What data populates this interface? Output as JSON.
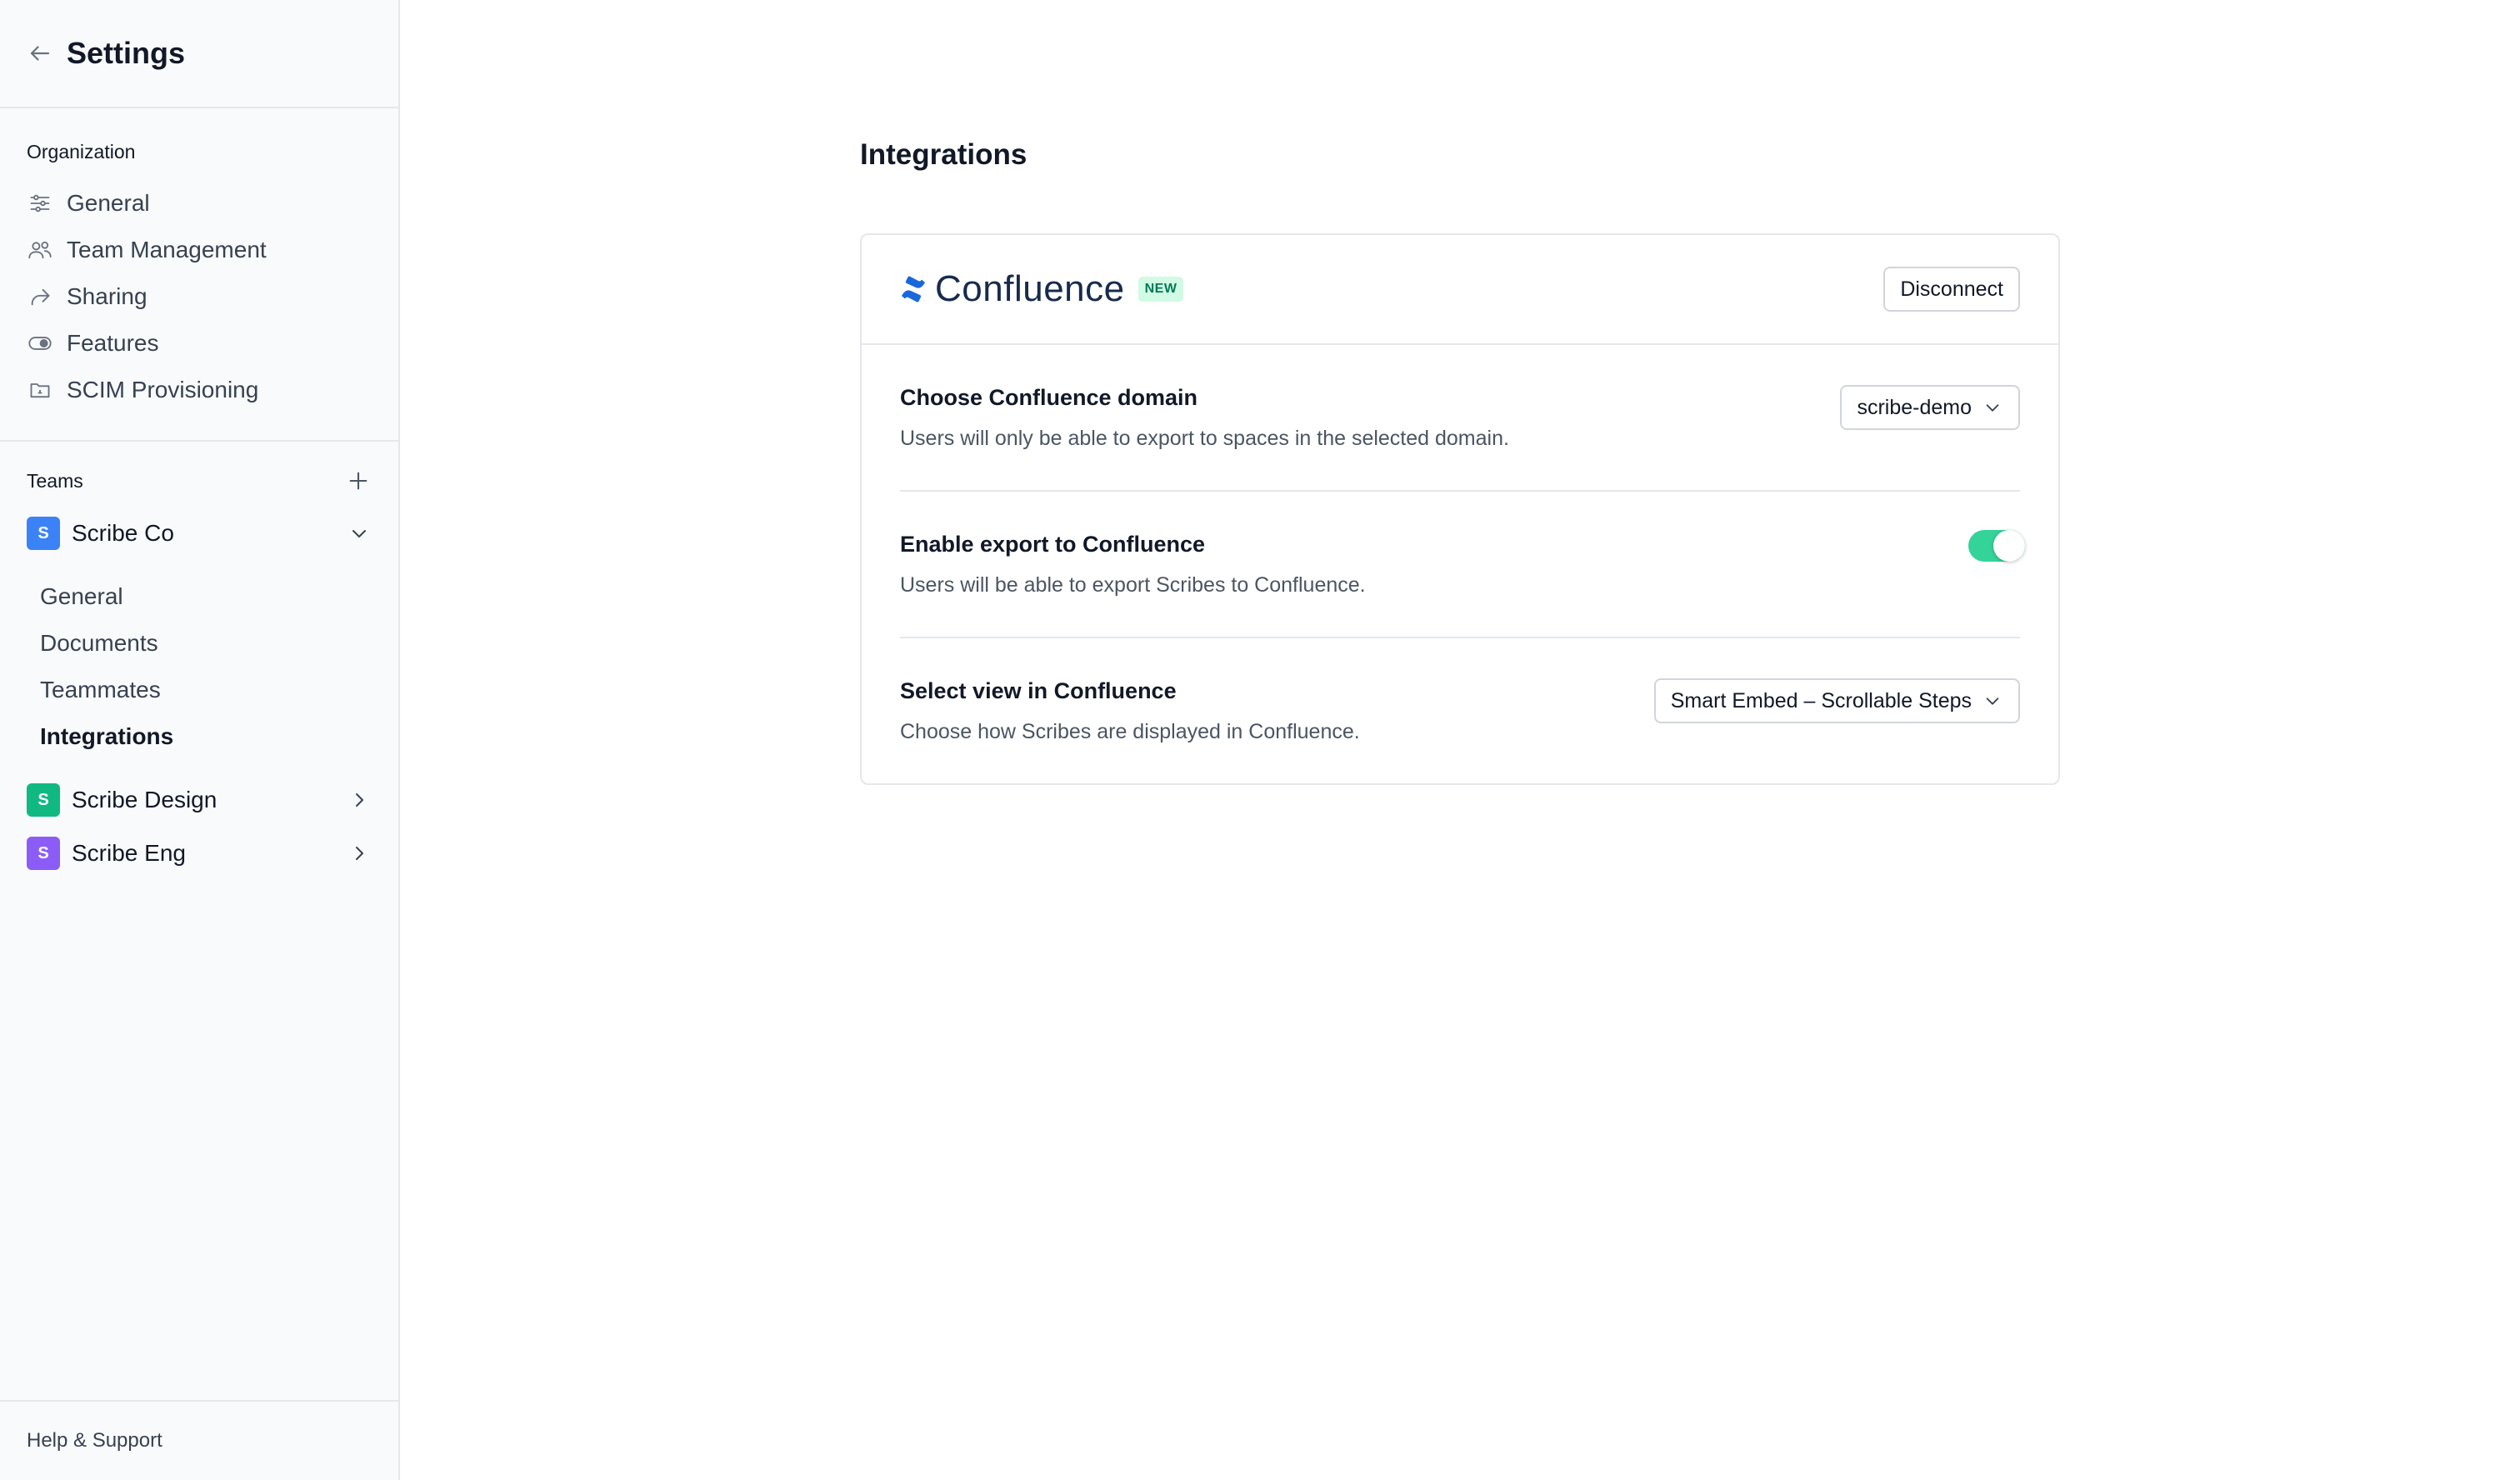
{
  "sidebar": {
    "title": "Settings",
    "organization": {
      "label": "Organization",
      "items": [
        {
          "label": "General",
          "icon": "sliders-icon"
        },
        {
          "label": "Team Management",
          "icon": "users-icon"
        },
        {
          "label": "Sharing",
          "icon": "share-icon"
        },
        {
          "label": "Features",
          "icon": "toggle-icon"
        },
        {
          "label": "SCIM Provisioning",
          "icon": "folder-icon"
        }
      ]
    },
    "teams": {
      "label": "Teams",
      "list": [
        {
          "badge": "S",
          "name": "Scribe Co",
          "color": "#3b82f6",
          "expanded": true,
          "subitems": [
            "General",
            "Documents",
            "Teammates",
            "Integrations"
          ],
          "active": "Integrations"
        },
        {
          "badge": "S",
          "name": "Scribe Design",
          "color": "#10b981",
          "expanded": false
        },
        {
          "badge": "S",
          "name": "Scribe Eng",
          "color": "#8b5cf6",
          "expanded": false
        }
      ]
    },
    "footer": "Help & Support"
  },
  "main": {
    "title": "Integrations",
    "integration": {
      "name": "Confluence",
      "badge": "NEW",
      "disconnect_label": "Disconnect",
      "settings": [
        {
          "title": "Choose Confluence domain",
          "description": "Users will only be able to export to spaces in the selected domain.",
          "control": "select",
          "value": "scribe-demo"
        },
        {
          "title": "Enable export to Confluence",
          "description": "Users will be able to export Scribes to Confluence.",
          "control": "toggle",
          "value": true
        },
        {
          "title": "Select view in Confluence",
          "description": "Choose how Scribes are displayed in Confluence.",
          "control": "select",
          "value": "Smart Embed – Scrollable Steps"
        }
      ]
    }
  },
  "colors": {
    "toggle_on": "#34d399",
    "confluence_blue": "#1868db",
    "new_badge_bg": "#d1fae5"
  }
}
